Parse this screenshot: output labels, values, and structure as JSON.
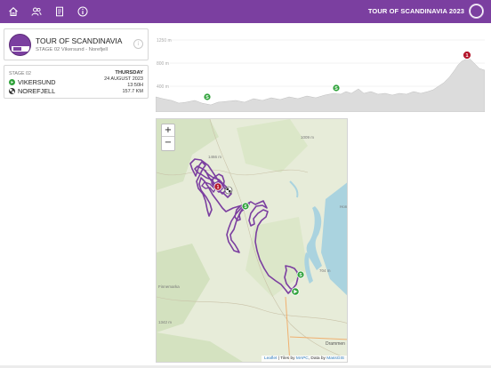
{
  "topbar": {
    "icons": [
      "home-icon",
      "users-icon",
      "document-icon",
      "info-icon"
    ],
    "race_title": "TOUR OF SCANDINAVIA 2023",
    "color": "#7b3fa0"
  },
  "header_card": {
    "title": "TOUR OF SCANDINAVIA",
    "subtitle": "STAGE 02 Vikersund - Norefjell",
    "info_glyph": "i"
  },
  "stage_card": {
    "stage_label": "STAGE 02",
    "start": "VIKERSUND",
    "finish": "NOREFJELL",
    "day": "THURSDAY",
    "date": "24 AUGUST 2023",
    "time": "13:50H",
    "distance": "157.7 KM"
  },
  "profile": {
    "y_labels": [
      "1250 m",
      "800 m",
      "400 m"
    ],
    "markers": [
      {
        "type": "sprint",
        "label": "S"
      },
      {
        "type": "sprint",
        "label": "S"
      },
      {
        "type": "kom",
        "label": "1"
      }
    ]
  },
  "map": {
    "zoom_in": "+",
    "zoom_out": "−",
    "labels": [
      "1009 m",
      "1466 m",
      "Hon",
      "704 m",
      "Drammen",
      "1342 m",
      "Finnemarka"
    ],
    "attribution": {
      "leaflet": "Leaflet",
      "sep1": " | Tiles by ",
      "mapc": "MAPC",
      "sep2": ", Data by ",
      "massgis": "MassGIS"
    },
    "markers": [
      "kom-marker",
      "finish-marker",
      "sprint-marker",
      "sprint-marker",
      "start-marker"
    ]
  },
  "colors": {
    "accent": "#7b3fa0",
    "sprint": "#2fa23a",
    "kom": "#b5182d",
    "route": "#7b3fa0",
    "water": "#aad3df"
  }
}
